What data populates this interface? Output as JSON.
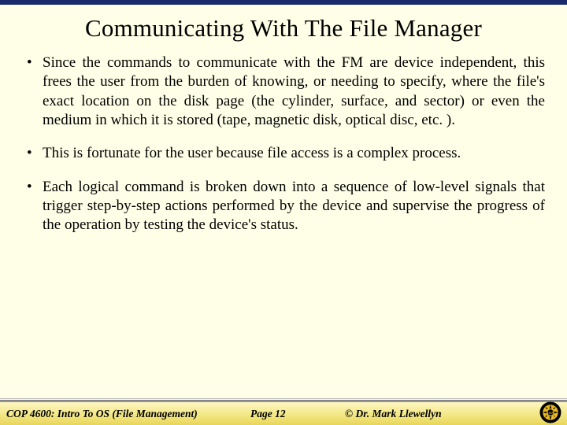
{
  "slide": {
    "title": "Communicating With The File Manager",
    "bullets": [
      "Since the commands to communicate with the FM are device independent, this frees the user from the burden of knowing, or needing to specify, where the file's exact location on the disk page (the cylinder, surface, and sector) or even the medium in which it is stored (tape, magnetic disk, optical disc, etc. ).",
      "This is fortunate for the user because file access is a complex process.",
      "Each logical command is broken down into a sequence of low-level signals that trigger step-by-step actions performed by the device and supervise the progress of the operation by testing the device's status."
    ]
  },
  "footer": {
    "course": "COP 4600: Intro To OS  (File Management)",
    "page": "Page 12",
    "copyright": "© Dr. Mark Llewellyn"
  }
}
